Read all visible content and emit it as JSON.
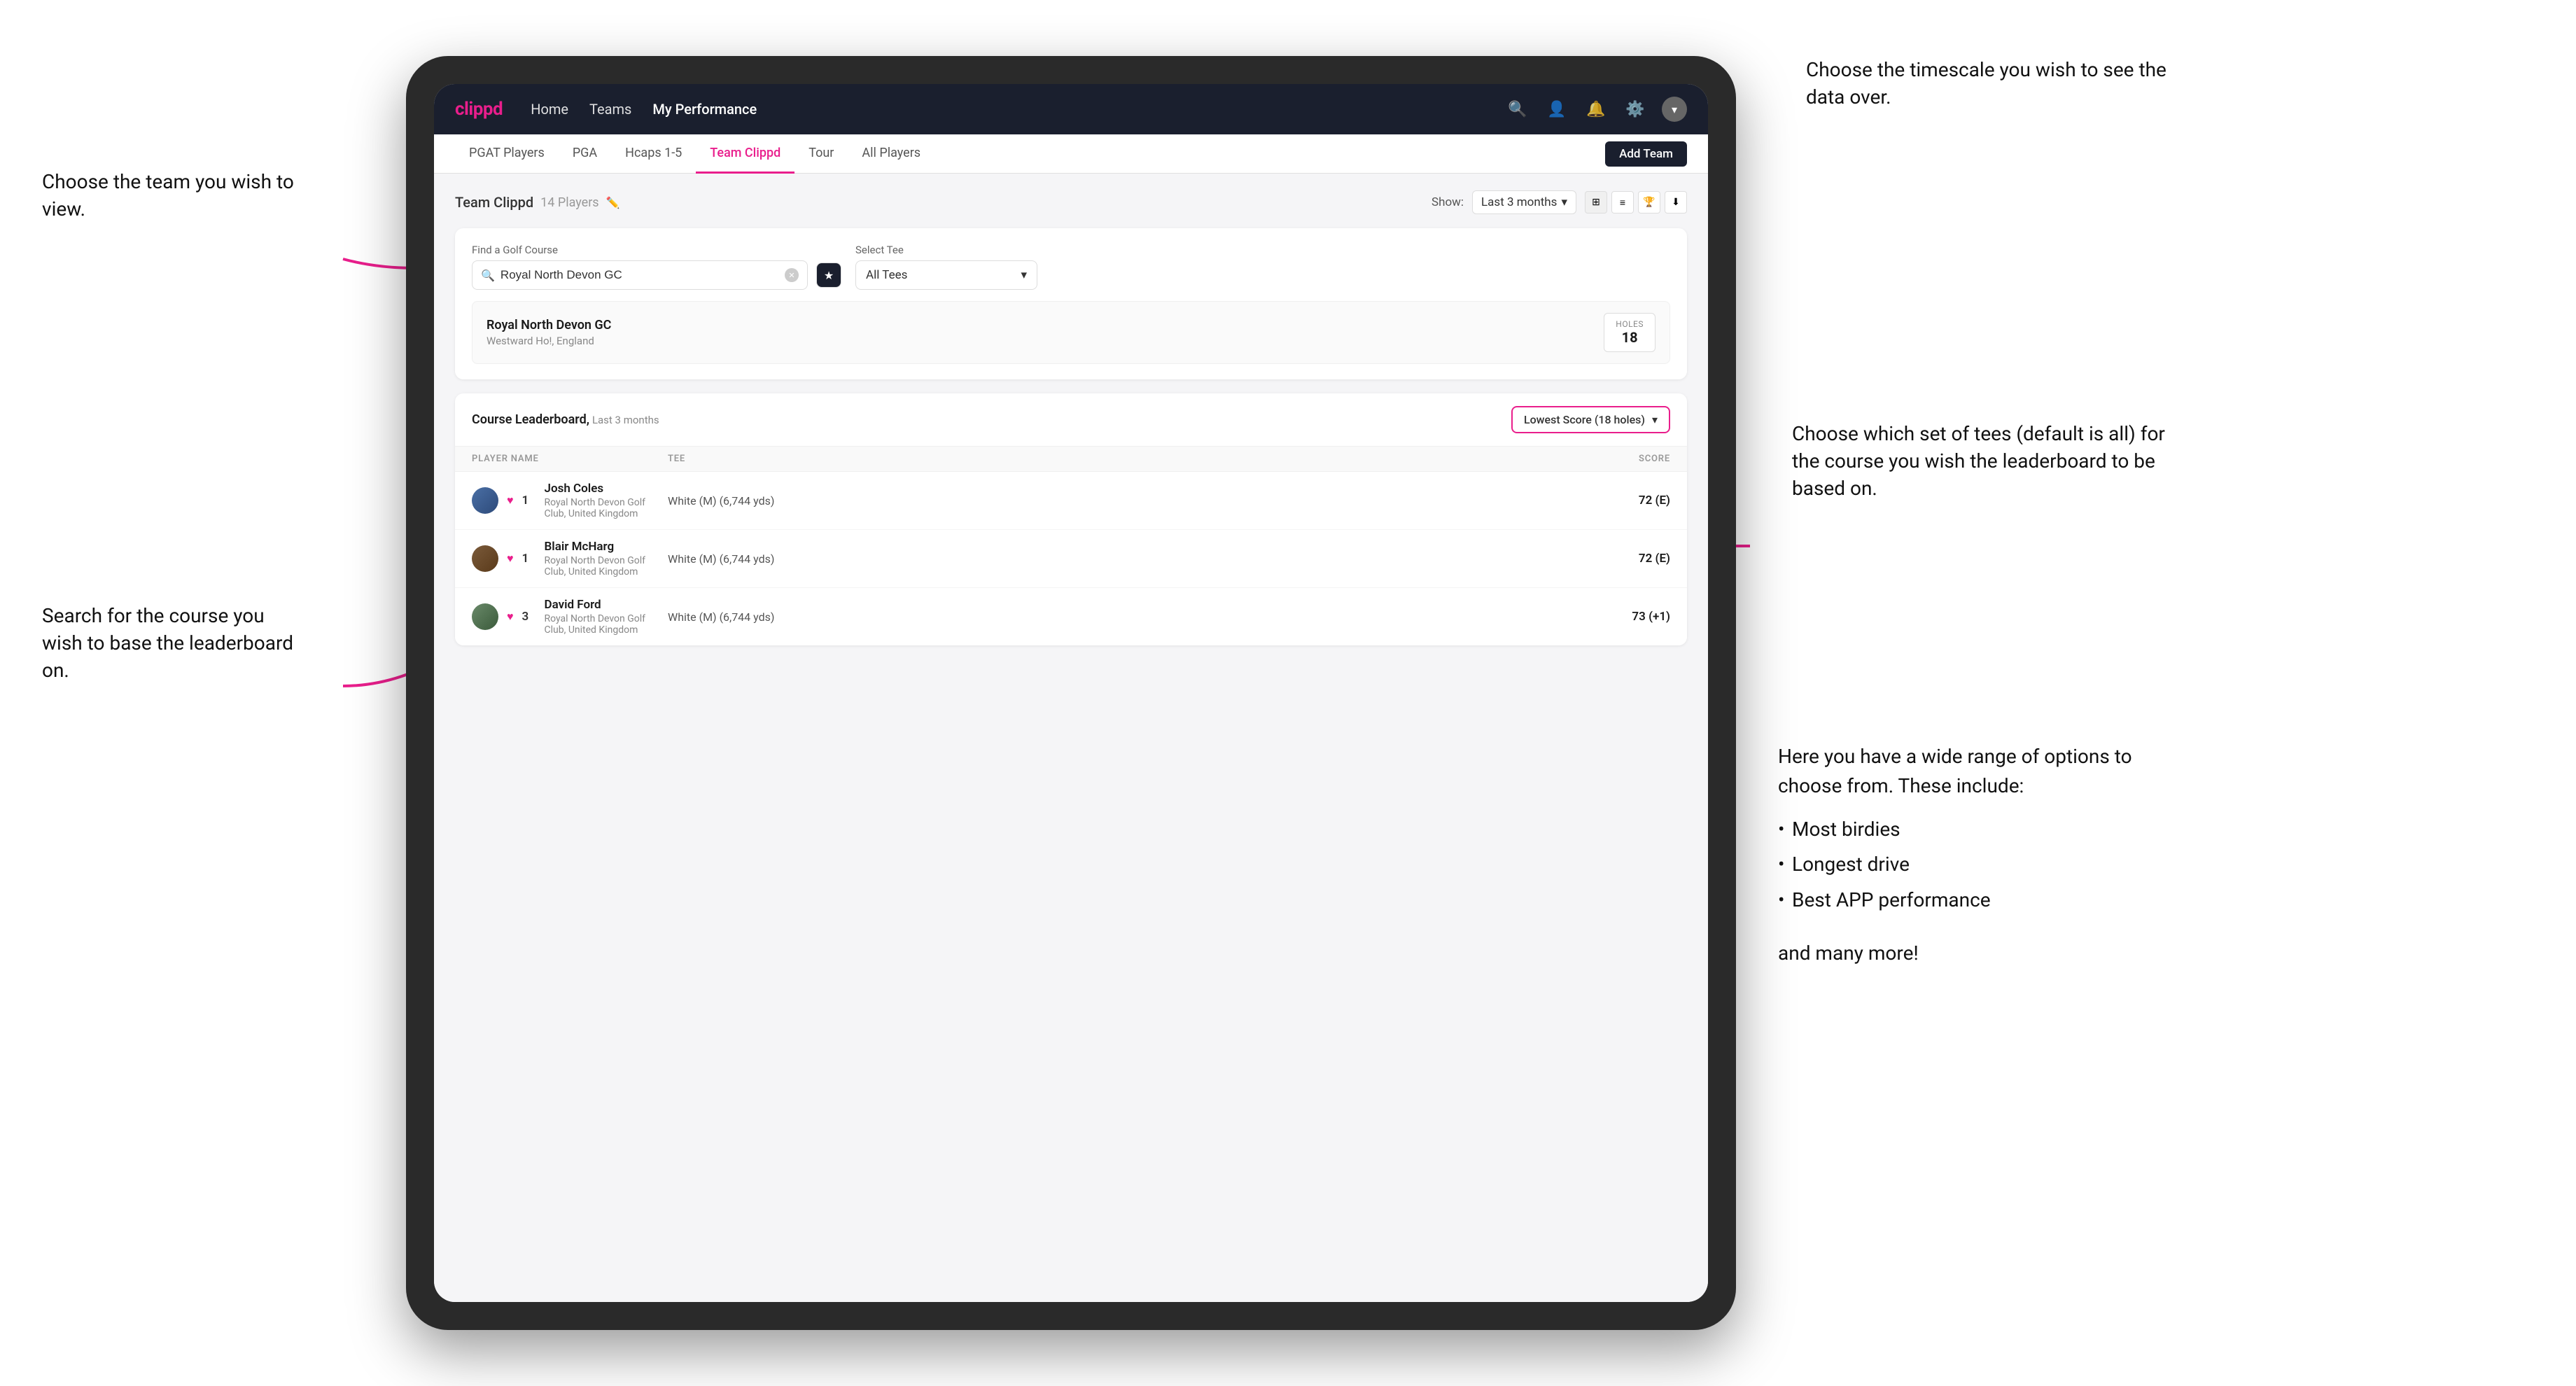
{
  "annotations": {
    "top_left_title": "Choose the team you\nwish to view.",
    "mid_left_title": "Search for the course\nyou wish to base the\nleaderboard on.",
    "top_right_title": "Choose the timescale you\nwish to see the data over.",
    "mid_right_title": "Choose which set of tees\n(default is all) for the course\nyou wish the leaderboard to\nbe based on.",
    "bottom_right_title": "Here you have a wide range\nof options to choose from.\nThese include:",
    "bullet_items": [
      "Most birdies",
      "Longest drive",
      "Best APP performance"
    ],
    "and_more": "and many more!"
  },
  "navbar": {
    "logo": "clippd",
    "links": [
      "Home",
      "Teams",
      "My Performance"
    ],
    "active_link": "My Performance",
    "icons": [
      "search",
      "person",
      "bell",
      "settings",
      "avatar"
    ]
  },
  "subnav": {
    "items": [
      "PGAT Players",
      "PGA",
      "Hcaps 1-5",
      "Team Clippd",
      "Tour",
      "All Players"
    ],
    "active": "Team Clippd",
    "add_team_label": "Add Team"
  },
  "team_header": {
    "title": "Team Clippd",
    "player_count": "14 Players",
    "show_label": "Show:",
    "time_range": "Last 3 months"
  },
  "course_search": {
    "label": "Find a Golf Course",
    "value": "Royal North Devon GC",
    "placeholder": "Find a Golf Course",
    "tee_label": "Select Tee",
    "tee_value": "All Tees"
  },
  "course_result": {
    "name": "Royal North Devon GC",
    "location": "Westward Ho!, England",
    "holes_label": "Holes",
    "holes_value": "18"
  },
  "leaderboard": {
    "title": "Course Leaderboard,",
    "subtitle": "Last 3 months",
    "score_type": "Lowest Score (18 holes)",
    "columns": [
      "PLAYER NAME",
      "TEE",
      "SCORE"
    ],
    "rows": [
      {
        "rank": "1",
        "name": "Josh Coles",
        "club": "Royal North Devon Golf Club, United Kingdom",
        "tee": "White (M) (6,744 yds)",
        "score": "72 (E)"
      },
      {
        "rank": "1",
        "name": "Blair McHarg",
        "club": "Royal North Devon Golf Club, United Kingdom",
        "tee": "White (M) (6,744 yds)",
        "score": "72 (E)"
      },
      {
        "rank": "3",
        "name": "David Ford",
        "club": "Royal North Devon Golf Club, United Kingdom",
        "tee": "White (M) (6,744 yds)",
        "score": "73 (+1)"
      }
    ]
  },
  "colors": {
    "primary": "#e91e8c",
    "dark_navy": "#1a1f2e",
    "bg_light": "#f5f5f7",
    "white": "#ffffff"
  }
}
